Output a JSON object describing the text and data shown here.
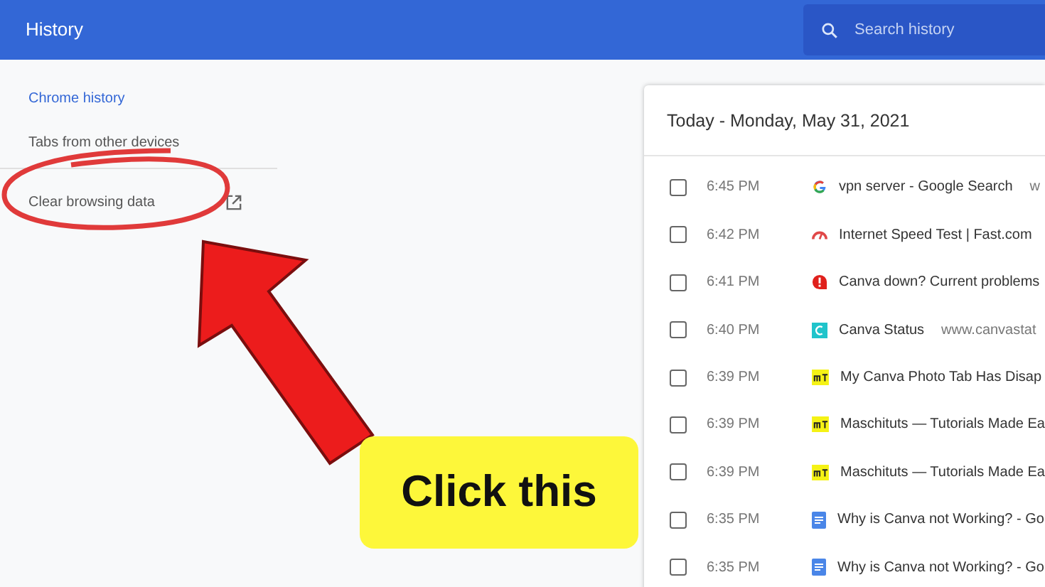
{
  "header": {
    "title": "History",
    "search": {
      "placeholder": "Search history"
    }
  },
  "sidebar": {
    "items": [
      {
        "label": "Chrome history",
        "selected": true,
        "kind": "link"
      },
      {
        "label": "Tabs from other devices",
        "selected": false,
        "kind": "link"
      },
      {
        "label": "Clear browsing data",
        "selected": false,
        "kind": "external"
      }
    ]
  },
  "history": {
    "heading": "Today - Monday, May 31, 2021",
    "rows": [
      {
        "checked": false,
        "time": "6:45 PM",
        "kind": "google",
        "title": "vpn server - Google Search",
        "domain": "w"
      },
      {
        "checked": false,
        "time": "6:42 PM",
        "kind": "gauge",
        "title": "Internet Speed Test | Fast.com"
      },
      {
        "checked": false,
        "time": "6:41 PM",
        "kind": "alert",
        "title": "Canva down? Current problems"
      },
      {
        "checked": false,
        "time": "6:40 PM",
        "kind": "canva",
        "title": "Canva Status",
        "domain": "www.canvastat"
      },
      {
        "checked": false,
        "time": "6:39 PM",
        "kind": "mt",
        "title": "My Canva Photo Tab Has Disap"
      },
      {
        "checked": false,
        "time": "6:39 PM",
        "kind": "mt",
        "title": "Maschituts — Tutorials Made Ea"
      },
      {
        "checked": false,
        "time": "6:39 PM",
        "kind": "mt",
        "title": "Maschituts — Tutorials Made Ea"
      },
      {
        "checked": false,
        "time": "6:35 PM",
        "kind": "doc",
        "title": "Why is Canva not Working? - Go"
      },
      {
        "checked": false,
        "time": "6:35 PM",
        "kind": "doc",
        "title": "Why is Canva not Working? - Go"
      }
    ]
  },
  "annotation": {
    "callout": "Click this"
  }
}
